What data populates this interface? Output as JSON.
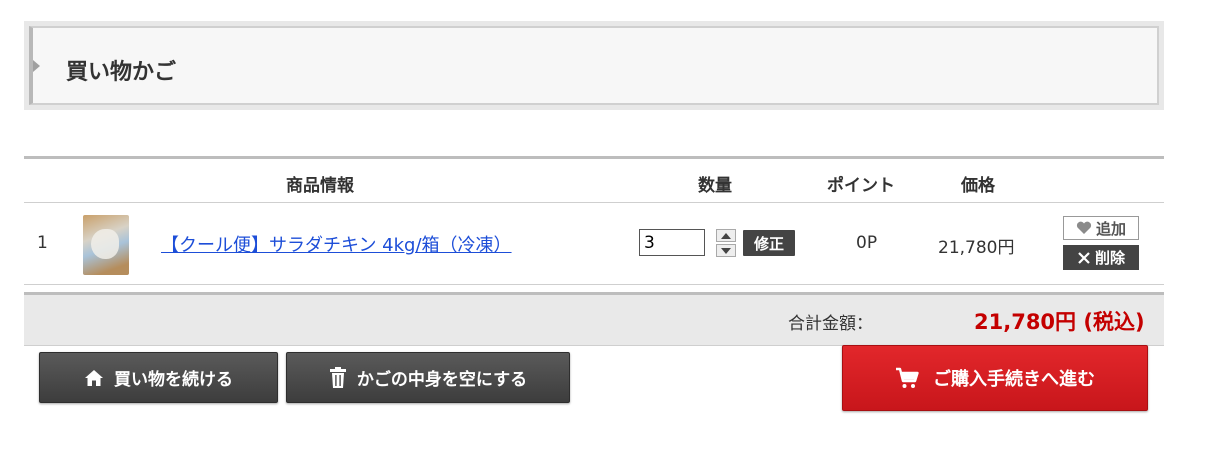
{
  "page": {
    "title": "買い物かご"
  },
  "table": {
    "headers": {
      "product": "商品情報",
      "quantity": "数量",
      "point": "ポイント",
      "price": "価格"
    },
    "rows": [
      {
        "index": "1",
        "product_name": "【クール便】サラダチキン 4kg/箱（冷凍）",
        "quantity": "3",
        "fix_label": "修正",
        "point": "0P",
        "price": "21,780円",
        "add_label": "追加",
        "delete_label": "削除"
      }
    ]
  },
  "total": {
    "label": "合計金額：",
    "amount": "21,780円 (税込)"
  },
  "buttons": {
    "continue_label": "買い物を続ける",
    "empty_label": "かごの中身を空にする",
    "checkout_label": "ご購入手続きへ進む"
  },
  "colors": {
    "accent_red": "#c40000",
    "checkout_bg": "#d81e22",
    "dark_button": "#444444",
    "link": "#1d4ed8"
  },
  "icons": [
    "home-icon",
    "trash-icon",
    "cart-icon",
    "heart-icon",
    "close-icon",
    "arrow-up-icon",
    "arrow-down-icon",
    "product-thumbnail"
  ]
}
